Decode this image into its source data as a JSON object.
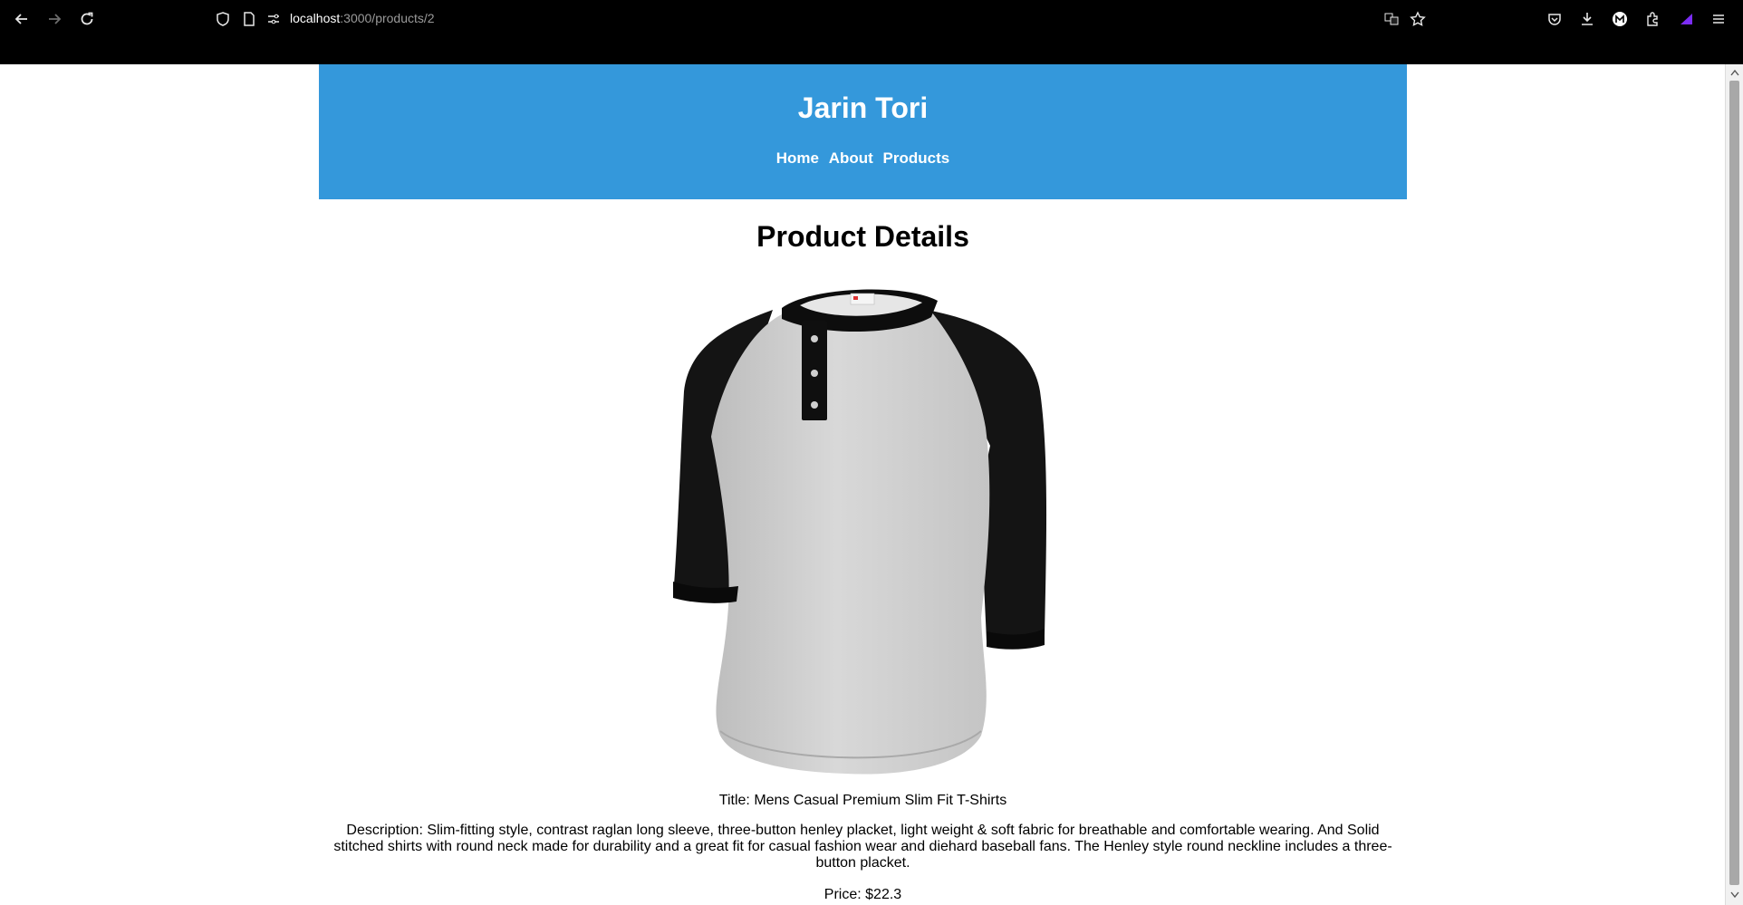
{
  "browser": {
    "url_host": "localhost",
    "url_path": ":3000/products/2",
    "icons": [
      "back-icon",
      "forward-icon",
      "reload-icon",
      "shield-icon",
      "page-icon",
      "site-info-icon",
      "translate-icon",
      "bookmark-star-icon",
      "pocket-icon",
      "download-icon",
      "account-icon",
      "extensions-icon",
      "extension-purple-icon",
      "menu-icon"
    ]
  },
  "site": {
    "title": "Jarin Tori",
    "nav": {
      "home": "Home",
      "about": "About",
      "products": "Products"
    }
  },
  "product_page": {
    "heading": "Product Details",
    "title_text": "Title: Mens Casual Premium Slim Fit T-Shirts",
    "description_text": "Description: Slim-fitting style, contrast raglan long sleeve, three-button henley placket, light weight & soft fabric for breathable and comfortable wearing. And Solid stitched shirts with round neck made for durability and a great fit for casual fashion wear and diehard baseball fans. The Henley style round neckline includes a three-button placket.",
    "price_text": "Price: $22.3"
  },
  "colors": {
    "header_bg": "#3498db",
    "chrome_bg": "#000000"
  }
}
